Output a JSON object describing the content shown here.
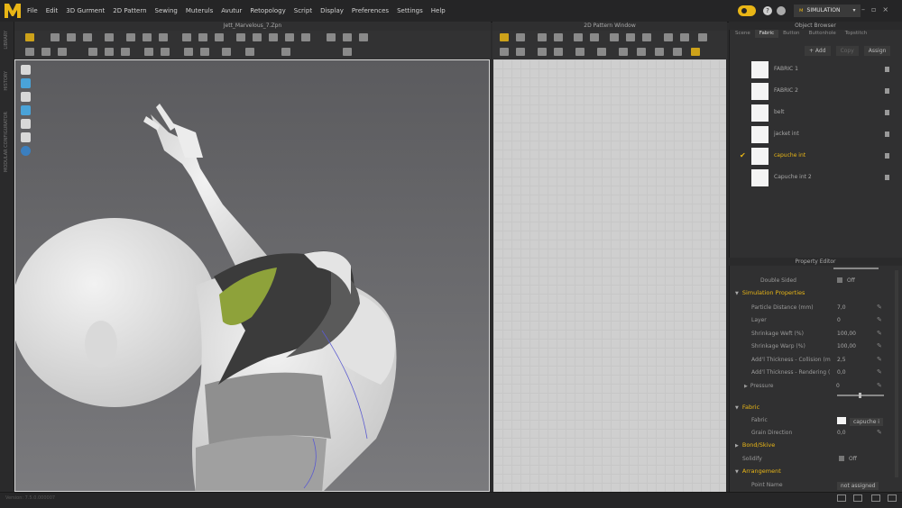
{
  "app": {
    "menus": [
      "File",
      "Edit",
      "3D Gurment",
      "2D Pattern",
      "Sewing",
      "Muteruls",
      "Avutur",
      "Retopology",
      "Script",
      "Display",
      "Preferences",
      "Settings",
      "Help"
    ],
    "simulation_label": "SIMULATION",
    "accent_color": "#e9b616"
  },
  "windows": {
    "three_d_title": "Jett_Marvelous_7.Zpn",
    "two_d_title": "2D Pattern Window"
  },
  "left_strip": {
    "tabs": [
      "LIBRARY",
      "HISTORY",
      "MODULAR CONFIGURATOR"
    ]
  },
  "object_browser": {
    "title": "Object Browser",
    "tabs": [
      "Scene",
      "Fabric",
      "Button",
      "Buttonhole",
      "Topstitch"
    ],
    "active_tab": "Fabric",
    "add_label": "+ Add",
    "copy_label": "Copy",
    "assign_label": "Assign",
    "fabrics": [
      {
        "name": "FABRIC 1"
      },
      {
        "name": "FABRIC 2"
      },
      {
        "name": "belt"
      },
      {
        "name": "jacket int"
      },
      {
        "name": "capuche int",
        "selected": true
      },
      {
        "name": "Capuche int 2"
      }
    ]
  },
  "property_editor": {
    "title": "Property Editor",
    "double_sided": {
      "label": "Double Sided",
      "value": "Off"
    },
    "simulation_properties": {
      "title": "Simulation Properties",
      "rows": [
        {
          "label": "Particle Distance (mm)",
          "value": "7,0"
        },
        {
          "label": "Layer",
          "value": "0"
        },
        {
          "label": "Shrinkage Weft (%)",
          "value": "100,00"
        },
        {
          "label": "Shrinkage Warp (%)",
          "value": "100,00"
        },
        {
          "label": "Add'l Thickness - Collision (m",
          "value": "2,5"
        },
        {
          "label": "Add'l Thickness - Rendering (",
          "value": "0,0"
        }
      ],
      "pressure": {
        "label": "Pressure",
        "value": "0"
      }
    },
    "fabric_section": {
      "title": "Fabric",
      "fabric_label": "Fabric",
      "fabric_value": "capuche i",
      "grain_label": "Grain Direction",
      "grain_value": "0,0"
    },
    "bond_skive": {
      "title": "Bond/Skive"
    },
    "solidify": {
      "label": "Solidify",
      "value": "Off"
    },
    "arrangement": {
      "title": "Arrangement",
      "point_name_label": "Point Name",
      "point_name_value": "not assigned"
    }
  },
  "status": {
    "version": "Version: 7.5.0.000007"
  }
}
